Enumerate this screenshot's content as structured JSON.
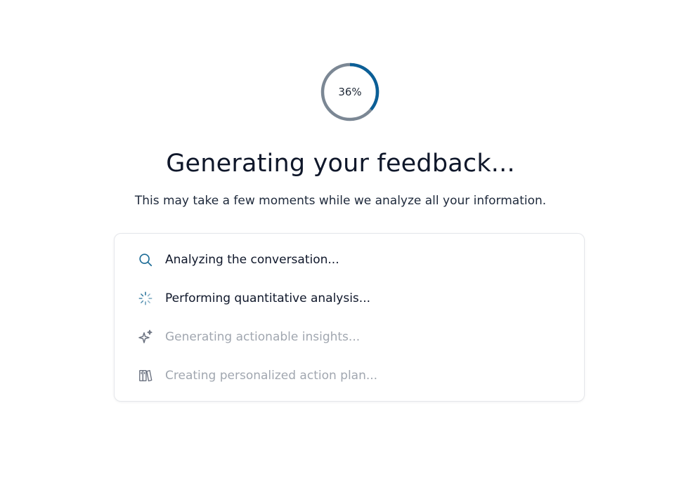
{
  "progress": {
    "percent": 36,
    "label": "36%",
    "track_color": "#7b8794",
    "fill_color": "#0b5f97"
  },
  "header": {
    "title": "Generating your feedback...",
    "subtitle": "This may take a few moments while we analyze all your information."
  },
  "steps": [
    {
      "label": "Analyzing the conversation...",
      "icon": "search-icon",
      "status": "active"
    },
    {
      "label": "Performing quantitative analysis...",
      "icon": "loader-icon",
      "status": "active"
    },
    {
      "label": "Generating actionable insights...",
      "icon": "sparkles-icon",
      "status": "pending"
    },
    {
      "label": "Creating personalized action plan...",
      "icon": "books-icon",
      "status": "pending"
    }
  ],
  "colors": {
    "active_icon": "#1a6a95",
    "pending_icon": "#6b7280",
    "active_text": "#0f172a",
    "pending_text": "#a1a7b0"
  }
}
